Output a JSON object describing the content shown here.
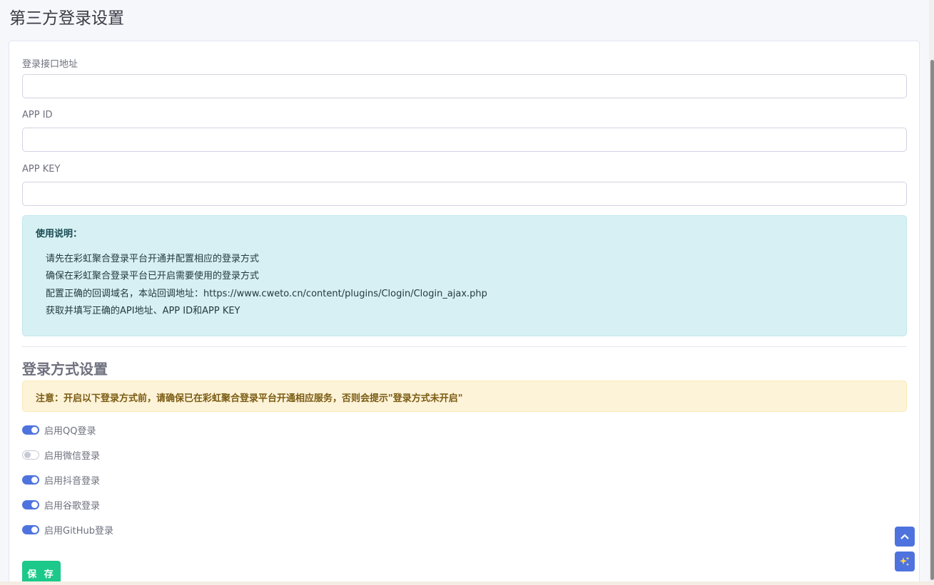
{
  "page": {
    "title": "第三方登录设置"
  },
  "form": {
    "api_url": {
      "label": "登录接口地址",
      "value": "",
      "placeholder": ""
    },
    "app_id": {
      "label": "APP ID",
      "value": "",
      "placeholder": ""
    },
    "app_key": {
      "label": "APP KEY",
      "value": "",
      "placeholder": ""
    }
  },
  "instructions": {
    "title": "使用说明：",
    "lines": [
      "请先在彩虹聚合登录平台开通并配置相应的登录方式",
      "确保在彩虹聚合登录平台已开启需要使用的登录方式",
      "配置正确的回调域名，本站回调地址：https://www.cweto.cn/content/plugins/Clogin/Clogin_ajax.php",
      "获取并填写正确的API地址、APP ID和APP KEY"
    ]
  },
  "login_methods": {
    "title": "登录方式设置",
    "warning": "注意：开启以下登录方式前，请确保已在彩虹聚合登录平台开通相应服务，否则会提示\"登录方式未开启\"",
    "toggles": [
      {
        "label": "启用QQ登录",
        "enabled": true
      },
      {
        "label": "启用微信登录",
        "enabled": false
      },
      {
        "label": "启用抖音登录",
        "enabled": true
      },
      {
        "label": "启用谷歌登录",
        "enabled": true
      },
      {
        "label": "启用GitHub登录",
        "enabled": true
      }
    ]
  },
  "actions": {
    "save_label": "保 存"
  },
  "floating": {
    "top_icon": "arrow-up-icon",
    "magic_icon": "sparkles-icon"
  },
  "colors": {
    "primary": "#4e73df",
    "success": "#1cc88a",
    "info_bg": "#d7f0f3",
    "warning_bg": "#fdf3d8"
  }
}
